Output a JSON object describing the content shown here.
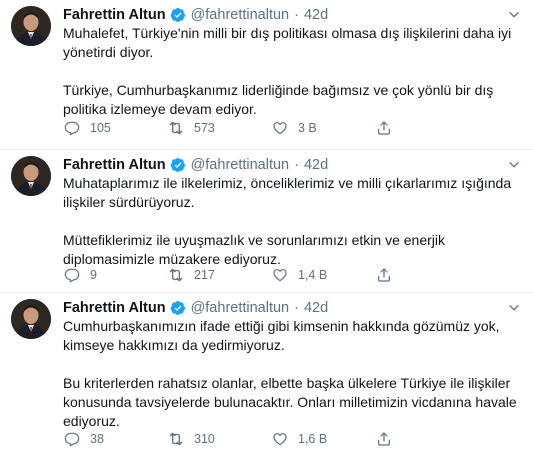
{
  "tweets": [
    {
      "name": "Fahrettin Altun",
      "handle": "@fahrettinaltun",
      "separator": "·",
      "time": "42d",
      "paragraphs": [
        "Muhalefet, Türkiye'nin milli bir dış politikası olmasa dış ilişkilerini daha iyi yönetirdi diyor.",
        "Türkiye, Cumhurbaşkanımız liderliğinde bağımsız ve çok yönlü bir dış politika izlemeye devam ediyor."
      ],
      "replies": "105",
      "retweets": "573",
      "likes": "3 B"
    },
    {
      "name": "Fahrettin Altun",
      "handle": "@fahrettinaltun",
      "separator": "·",
      "time": "42d",
      "paragraphs": [
        "Muhataplarımız ile ilkelerimiz, önceliklerimiz ve milli çıkarlarımız ışığında ilişkiler sürdürüyoruz.",
        "Müttefiklerimiz ile uyuşmazlık ve sorunlarımızı etkin ve enerjik diplomasimizle müzakere ediyoruz."
      ],
      "replies": "9",
      "retweets": "217",
      "likes": "1,4 B"
    },
    {
      "name": "Fahrettin Altun",
      "handle": "@fahrettinaltun",
      "separator": "·",
      "time": "42d",
      "paragraphs": [
        "Cumhurbaşkanımızın ifade ettiği gibi kimsenin hakkında gözümüz yok, kimseye hakkımızı da yedirmiyoruz.",
        "Bu kriterlerden rahatsız olanlar, elbette başka ülkelere Türkiye ile ilişkiler konusunda tavsiyelerde bulunacaktır. Onları milletimizin vicdanına havale ediyoruz."
      ],
      "replies": "38",
      "retweets": "310",
      "likes": "1,6 B"
    }
  ],
  "colors": {
    "verified": "#1da1f2",
    "secondary_text": "#5b7083",
    "divider": "#e6ecf0"
  },
  "icons": {
    "verified": "verified-badge-icon",
    "caret": "chevron-down-icon",
    "reply": "reply-icon",
    "retweet": "retweet-icon",
    "like": "heart-icon",
    "share": "share-icon"
  }
}
